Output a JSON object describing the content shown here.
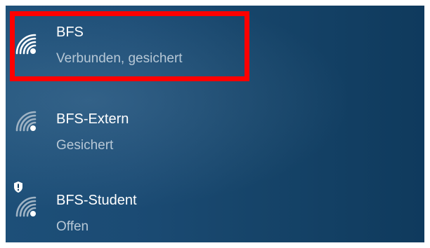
{
  "networks": [
    {
      "name": "BFS",
      "status": "Verbunden, gesichert",
      "icon": "wifi-secured-icon"
    },
    {
      "name": "BFS-Extern",
      "status": "Gesichert",
      "icon": "wifi-secured-icon"
    },
    {
      "name": "BFS-Student",
      "status": "Offen",
      "icon": "wifi-open-warning-icon"
    }
  ],
  "colors": {
    "panel_background": "#1b4b74",
    "highlight_border": "#ff0000",
    "name_text": "#ffffff",
    "status_text": "#b7c8d6"
  }
}
